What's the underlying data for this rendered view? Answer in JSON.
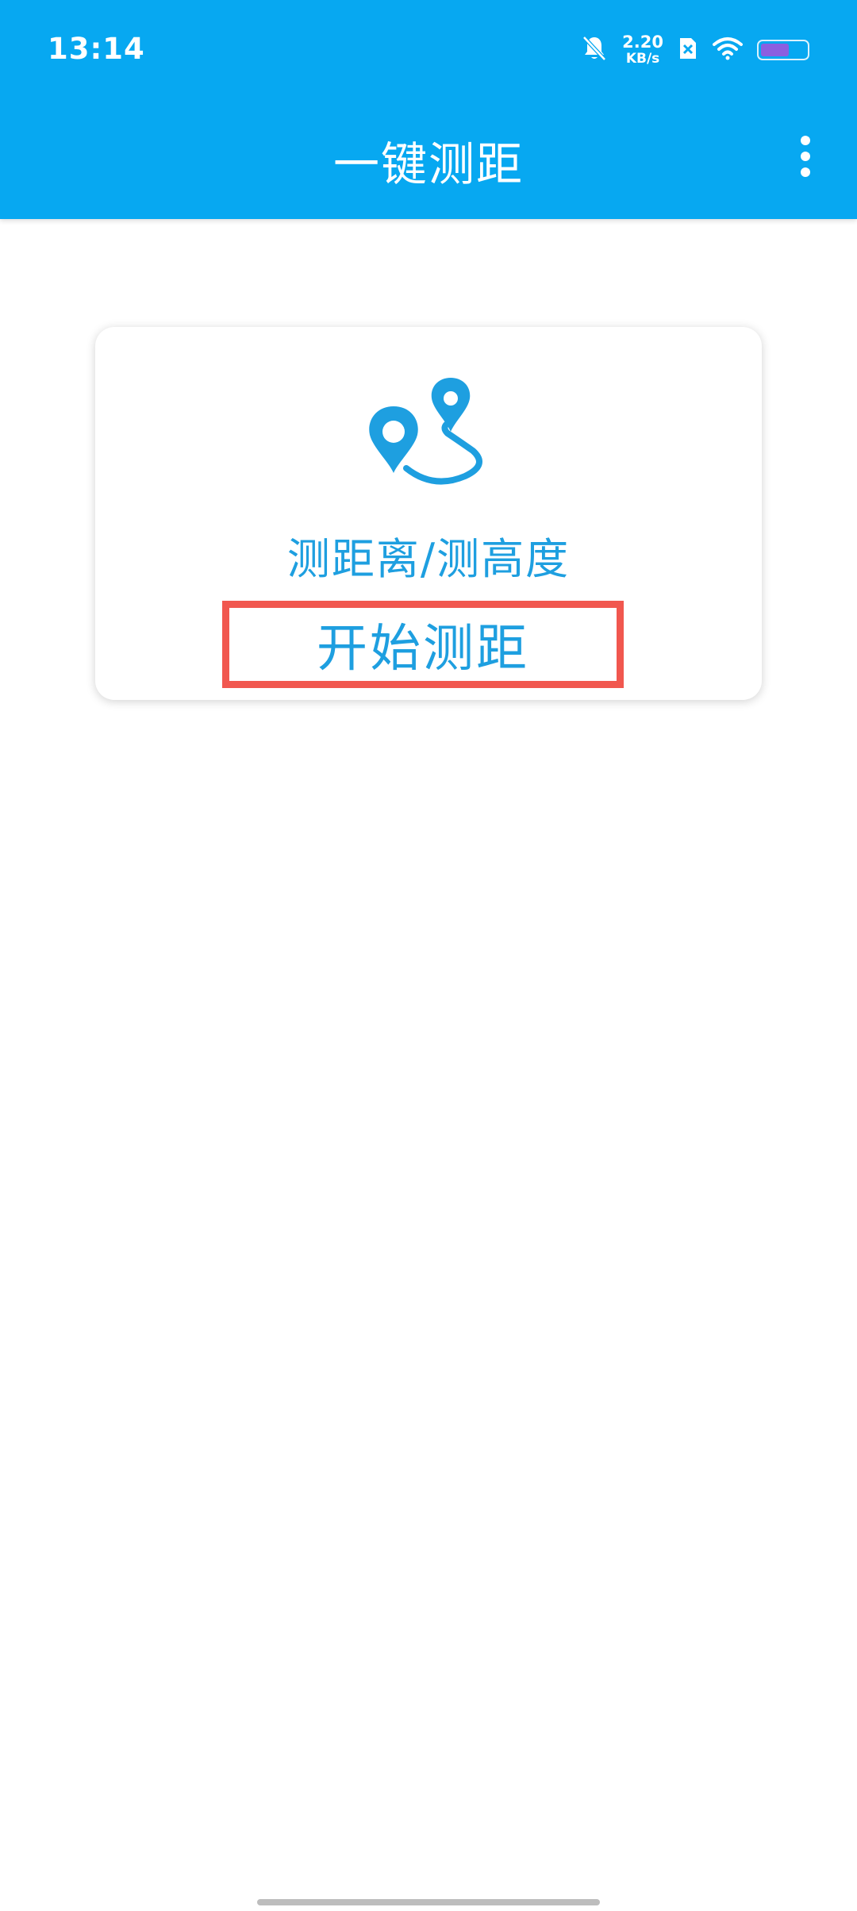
{
  "status_bar": {
    "time": "13:14",
    "net_speed_value": "2.20",
    "net_speed_unit": "KB/s",
    "icons": [
      "bell-off-icon",
      "sim-off-icon",
      "wifi-icon",
      "battery-icon"
    ],
    "battery_color": "#8B5FE0"
  },
  "app_bar": {
    "title": "一键测距",
    "menu_icon": "more-vert-icon",
    "background_color": "#07A8F1"
  },
  "card": {
    "icon": "route-pins-icon",
    "title": "测距离/测高度",
    "button_label": "开始测距",
    "accent_color": "#1E9FE0",
    "highlight_color": "#F1574F"
  }
}
